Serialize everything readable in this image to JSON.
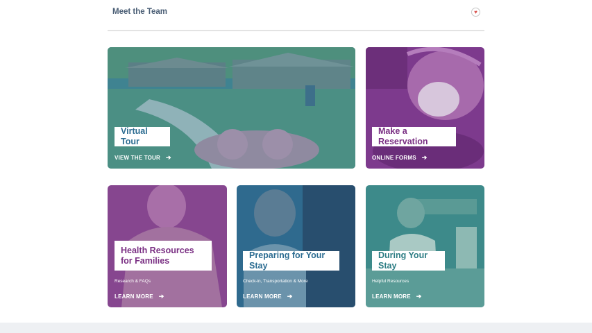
{
  "header": {
    "title": "Meet the Team",
    "icon": "heart-icon"
  },
  "cards": [
    {
      "id": "virtual-tour",
      "title": "Virtual Tour",
      "subtitle": "",
      "cta": "VIEW THE TOUR",
      "title_color": "#2d6d92",
      "overlay_color": "#3a7d92"
    },
    {
      "id": "make-reservation",
      "title": "Make a Reservation",
      "subtitle": "",
      "cta": "ONLINE FORMS",
      "title_color": "#7a2f83",
      "overlay_color": "#7d3a8d"
    },
    {
      "id": "health-resources",
      "title": "Health Resources for Families",
      "subtitle": "Research & FAQs",
      "cta": "LEARN MORE",
      "title_color": "#7a2f83",
      "overlay_color": "#86468f"
    },
    {
      "id": "preparing-stay",
      "title": "Preparing for Your Stay",
      "subtitle": "Check-in, Transportation & More",
      "cta": "LEARN MORE",
      "title_color": "#2d6d92",
      "overlay_color": "#2f6a8e"
    },
    {
      "id": "during-stay",
      "title": "During Your Stay",
      "subtitle": "Helpful Resources",
      "cta": "LEARN MORE",
      "title_color": "#2d7d84",
      "overlay_color": "#3d8a8a"
    }
  ]
}
